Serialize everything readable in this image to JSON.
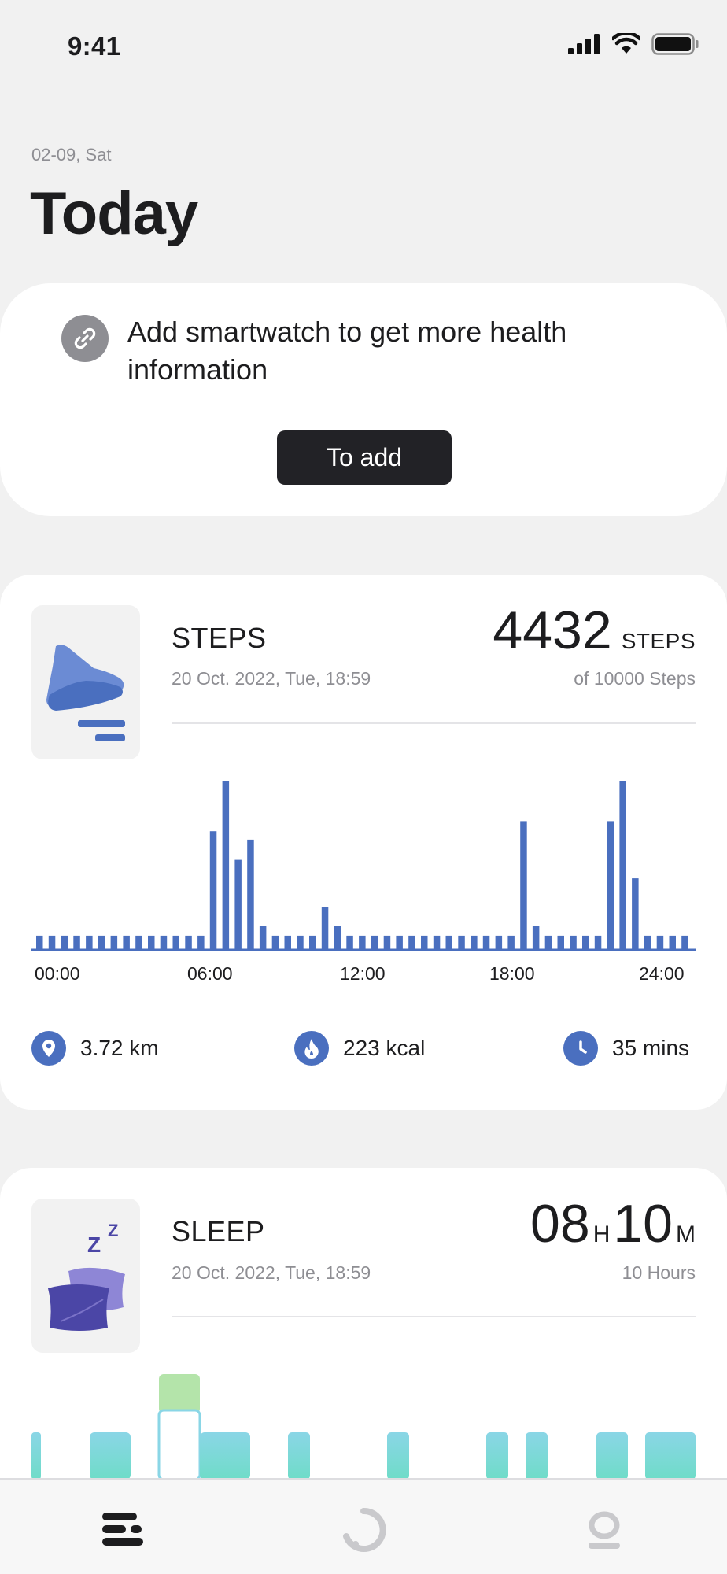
{
  "status_bar": {
    "time": "9:41"
  },
  "header": {
    "date": "02-09, Sat",
    "title": "Today"
  },
  "add_card": {
    "message": "Add smartwatch to get more health information",
    "button_label": "To add"
  },
  "steps": {
    "title": "STEPS",
    "date": "20 Oct. 2022, Tue, 18:59",
    "value": "4432",
    "unit": "STEPS",
    "goal": "of 10000 Steps",
    "stats": {
      "distance": "3.72 km",
      "calories": "223 kcal",
      "duration": "35 mins"
    },
    "colors": {
      "accent": "#4a6fbf"
    }
  },
  "sleep": {
    "title": "SLEEP",
    "date": "20 Oct. 2022, Tue, 18:59",
    "hours": "08",
    "hours_unit": "H",
    "minutes": "10",
    "minutes_unit": "M",
    "sub": "10 Hours"
  },
  "chart_data": {
    "type": "bar",
    "xlabels": [
      "00:00",
      "06:00",
      "12:00",
      "18:00",
      "24:00"
    ],
    "values": [
      8,
      8,
      8,
      8,
      8,
      8,
      8,
      8,
      8,
      8,
      8,
      8,
      8,
      8,
      70,
      100,
      53,
      65,
      14,
      8,
      8,
      8,
      8,
      25,
      14,
      8,
      8,
      8,
      8,
      8,
      8,
      8,
      8,
      8,
      8,
      8,
      8,
      8,
      8,
      76,
      14,
      8,
      8,
      8,
      8,
      8,
      76,
      100,
      42,
      8,
      8,
      8,
      8
    ],
    "ylim": [
      0,
      100
    ],
    "color": "#4a6fbf"
  },
  "tabs": [
    {
      "name": "today"
    },
    {
      "name": "activity"
    },
    {
      "name": "profile"
    }
  ]
}
